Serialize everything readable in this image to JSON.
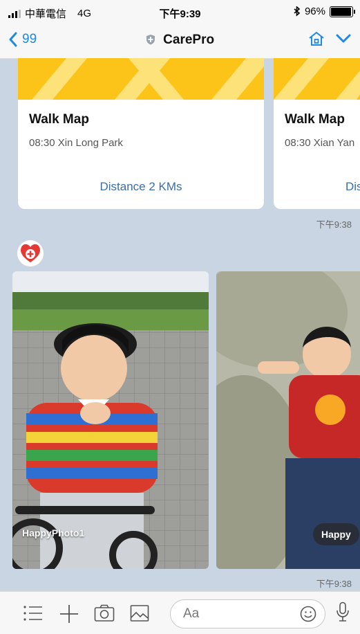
{
  "status_bar": {
    "carrier": "中華電信",
    "network": "4G",
    "time": "下午9:39",
    "battery_text": "96%",
    "battery_level": 0.96
  },
  "nav": {
    "back_count": "99",
    "title": "CarePro"
  },
  "cards": [
    {
      "title": "Walk Map",
      "subtitle": "08:30 Xin Long Park",
      "link": "Distance 2 KMs"
    },
    {
      "title": "Walk Map",
      "subtitle": "08:30 Xian Yan",
      "link": "Dis"
    }
  ],
  "timestamps": [
    "下午9:38",
    "下午9:38"
  ],
  "photos": [
    {
      "label": "HappyPhoto1"
    },
    {
      "label": "Happy"
    }
  ],
  "input": {
    "placeholder": "Aa"
  },
  "colors": {
    "accent": "#1e88e5",
    "chat_bg": "#c9d5e3",
    "banner": "#fcc419",
    "link": "#3b6ea5"
  }
}
